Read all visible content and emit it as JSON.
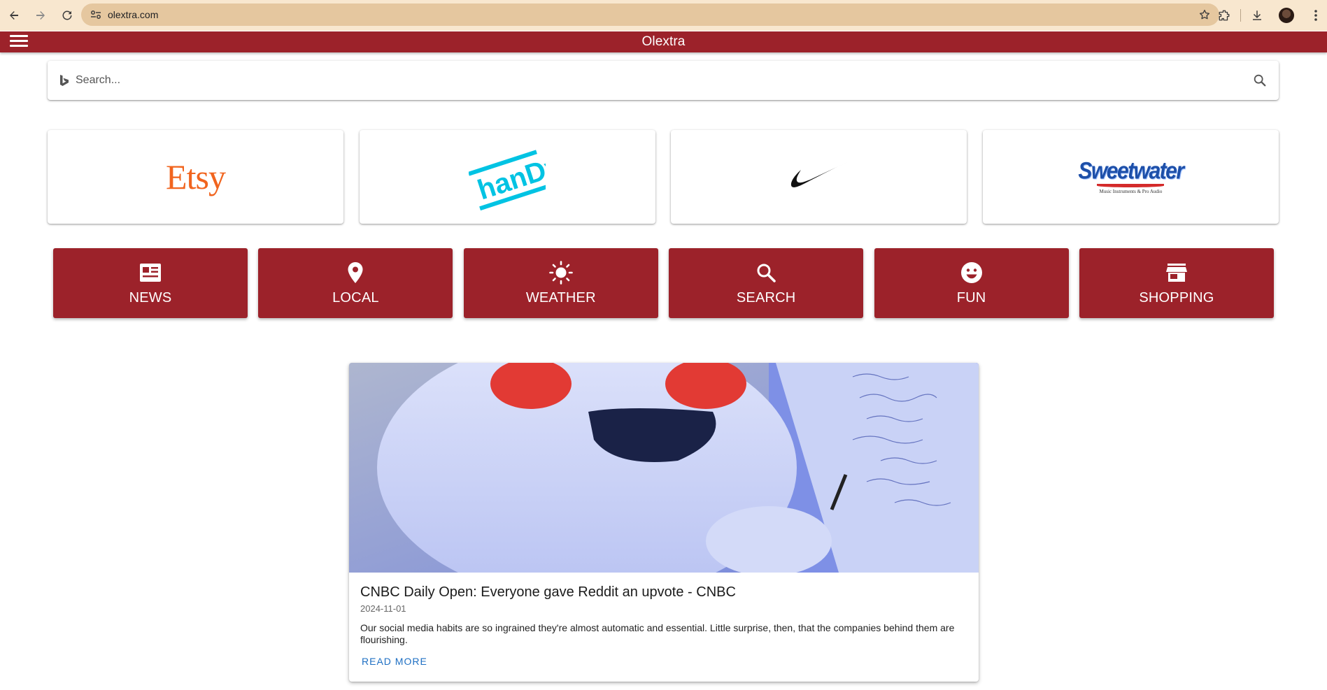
{
  "browser": {
    "url": "olextra.com",
    "icons": [
      "back-icon",
      "forward-icon",
      "reload-icon",
      "site-info-icon",
      "bookmark-star-icon",
      "extensions-icon",
      "download-icon",
      "profile-avatar",
      "more-icon"
    ]
  },
  "appbar": {
    "title": "Olextra",
    "color": "#9c222a"
  },
  "search": {
    "placeholder": "Search..."
  },
  "brands": [
    {
      "name": "Etsy",
      "logo_text": "Etsy",
      "color": "#f1641e"
    },
    {
      "name": "Handy",
      "logo_text": "hanDy",
      "color": "#00c3e3"
    },
    {
      "name": "Nike",
      "logo_text": "",
      "color": "#111111"
    },
    {
      "name": "Sweetwater",
      "logo_text": "Sweetwater",
      "tagline": "Music Instruments & Pro Audio",
      "color": "#1d4fa8"
    }
  ],
  "categories": [
    {
      "label": "NEWS",
      "icon": "newspaper-icon"
    },
    {
      "label": "LOCAL",
      "icon": "location-pin-icon"
    },
    {
      "label": "WEATHER",
      "icon": "sun-icon"
    },
    {
      "label": "SEARCH",
      "icon": "search-icon"
    },
    {
      "label": "FUN",
      "icon": "smiley-icon"
    },
    {
      "label": "SHOPPING",
      "icon": "storefront-icon"
    }
  ],
  "news": {
    "headline": "CNBC Daily Open: Everyone gave Reddit an upvote - CNBC",
    "date": "2024-11-01",
    "description": "Our social media habits are so ingrained they're almost automatic and essential. Little surprise, then, that the companies behind them are flourishing.",
    "read_more": "READ MORE",
    "link_color": "#1e6fc3"
  }
}
